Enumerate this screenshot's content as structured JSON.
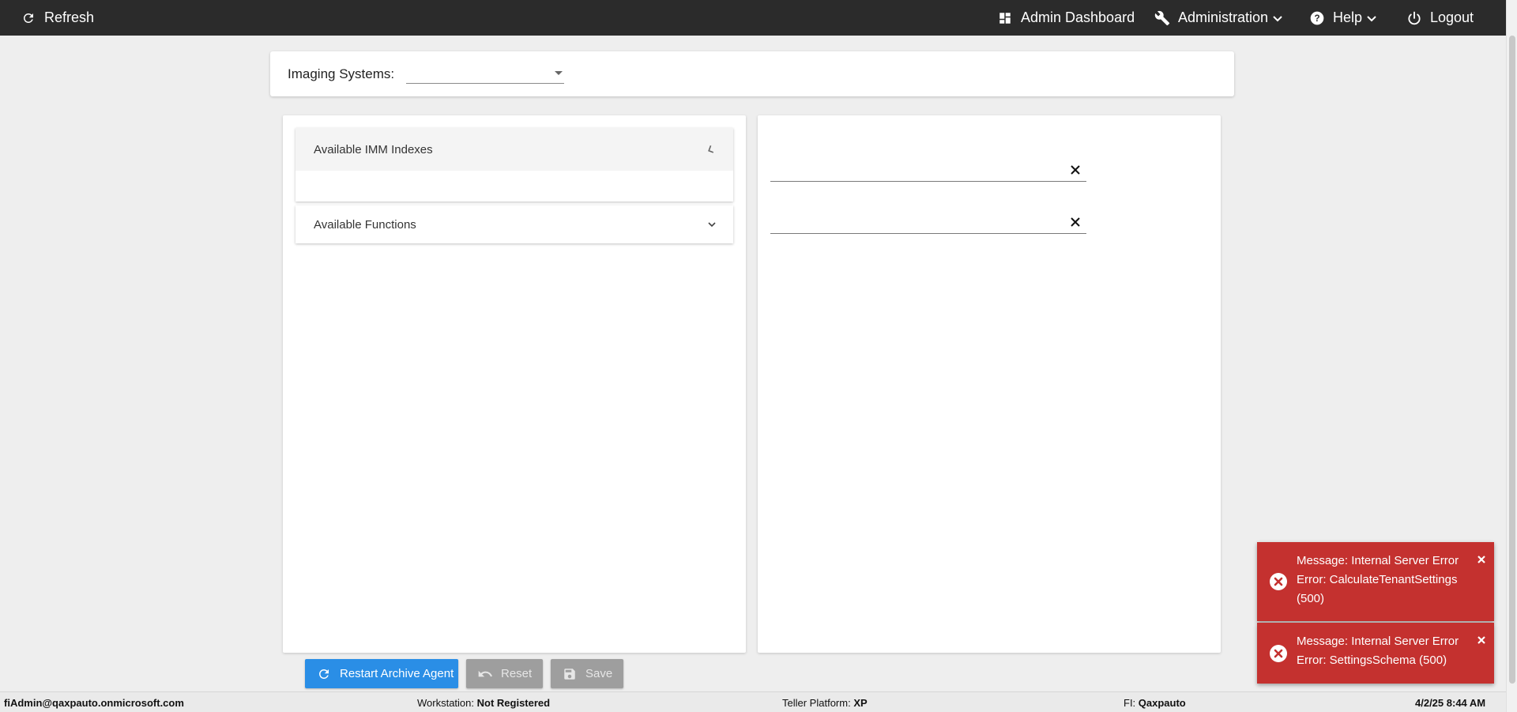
{
  "topbar": {
    "refresh": "Refresh",
    "admin_dashboard": "Admin Dashboard",
    "administration": "Administration",
    "help": "Help",
    "logout": "Logout"
  },
  "imaging": {
    "label": "Imaging Systems:",
    "selected": ""
  },
  "left_panel": {
    "imm_indexes": "Available IMM Indexes",
    "functions": "Available Functions"
  },
  "right_panel": {
    "field1_value": "",
    "field2_value": ""
  },
  "buttons": {
    "restart": "Restart Archive Agent",
    "reset": "Reset",
    "save": "Save"
  },
  "status": {
    "user": "fiAdmin@qaxpauto.onmicrosoft.com",
    "workstation_label": "Workstation:",
    "workstation_value": "Not Registered",
    "teller_label": "Teller Platform:",
    "teller_value": "XP",
    "fi_label": "FI:",
    "fi_value": "Qaxpauto",
    "datetime": "4/2/25 8:44 AM"
  },
  "toasts": [
    {
      "line1": "Message: Internal Server Error",
      "line2": "Error: CalculateTenantSettings",
      "line3": "(500)"
    },
    {
      "line1": "Message: Internal Server Error",
      "line2": "Error: SettingsSchema (500)"
    }
  ],
  "colors": {
    "topbar": "#2b2b2b",
    "primary_button": "#2a8ee6",
    "disabled_button": "#9e9e9e",
    "toast_error": "#c4312f"
  }
}
